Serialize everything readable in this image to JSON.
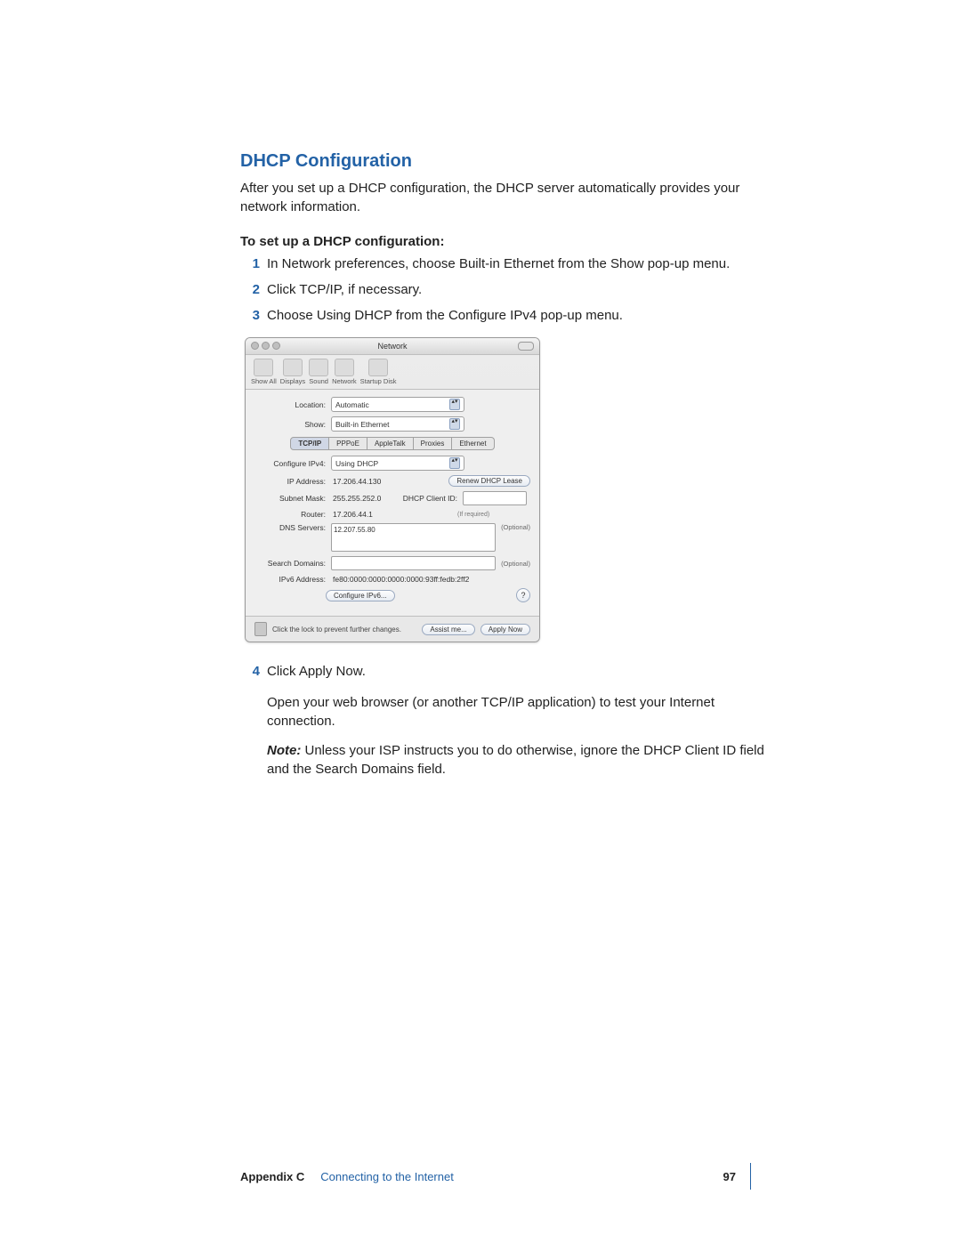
{
  "heading": "DHCP Configuration",
  "intro": "After you set up a DHCP configuration, the DHCP server automatically provides your network information.",
  "subhead": "To set up a DHCP configuration:",
  "steps": {
    "s1": "In Network preferences, choose Built-in Ethernet from the Show pop-up menu.",
    "s2": "Click TCP/IP, if necessary.",
    "s3": "Choose Using DHCP from the Configure IPv4 pop-up menu.",
    "s4": "Click Apply Now."
  },
  "after4_para1": "Open your web browser (or another TCP/IP application) to test your Internet connection.",
  "after4_note_label": "Note:",
  "after4_note_body": "  Unless your ISP instructs you to do otherwise, ignore the DHCP Client ID field and the Search Domains field.",
  "window": {
    "title": "Network",
    "toolbar": {
      "show_all": "Show All",
      "displays": "Displays",
      "sound": "Sound",
      "network": "Network",
      "startup": "Startup Disk"
    },
    "location_label": "Location:",
    "location_value": "Automatic",
    "show_label": "Show:",
    "show_value": "Built-in Ethernet",
    "tabs": {
      "tcpip": "TCP/IP",
      "pppoe": "PPPoE",
      "appletalk": "AppleTalk",
      "proxies": "Proxies",
      "ethernet": "Ethernet"
    },
    "configure_label": "Configure IPv4:",
    "configure_value": "Using DHCP",
    "ip_label": "IP Address:",
    "ip_value": "17.206.44.130",
    "renew_btn": "Renew DHCP Lease",
    "subnet_label": "Subnet Mask:",
    "subnet_value": "255.255.252.0",
    "clientid_label": "DHCP Client ID:",
    "clientid_hint": "(If required)",
    "router_label": "Router:",
    "router_value": "17.206.44.1",
    "dns_label": "DNS Servers:",
    "dns_value": "12.207.55.80",
    "optional": "(Optional)",
    "search_label": "Search Domains:",
    "ipv6_label": "IPv6 Address:",
    "ipv6_value": "fe80:0000:0000:0000:0000:93ff:fedb:2ff2",
    "configure_ipv6_btn": "Configure IPv6...",
    "help": "?",
    "lock_text": "Click the lock to prevent further changes.",
    "assist_btn": "Assist me...",
    "apply_btn": "Apply Now"
  },
  "footer": {
    "appendix": "Appendix C",
    "chapter": "Connecting to the Internet",
    "page": "97"
  }
}
